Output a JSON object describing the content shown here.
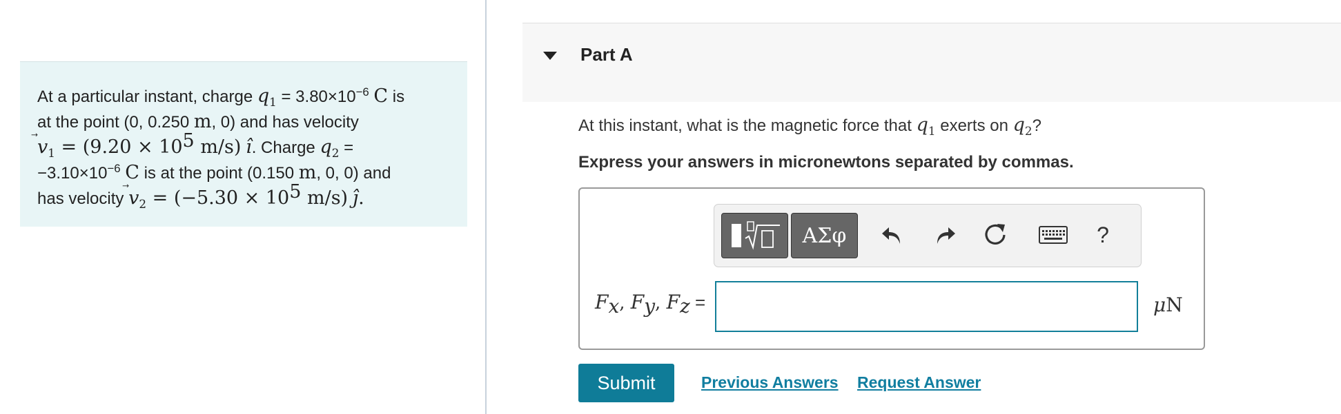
{
  "problem": {
    "l1_a": "At a particular instant, charge ",
    "q1_sym": "q",
    "q1_sub": "1",
    "l1_b": " = 3.80×10",
    "q1_exp": "−6",
    "l1_unit": "C",
    "l1_c": " is",
    "l2_a": "at the point (0, 0.250 ",
    "l2_unit": "m",
    "l2_b": ", 0) and has velocity",
    "v1_sym": "v",
    "v1_sub": "1",
    "v1_eq": " = ",
    "v1_val": "(9.20 × 10",
    "v1_exp": "5",
    "v1_unit": " m/s)",
    "v1_dir": "ı̂",
    "l3_b": ". Charge ",
    "q2_sym": "q",
    "q2_sub": "2",
    "l3_c": " =",
    "l4_a": "−3.10×10",
    "q2_exp": "−6",
    "l4_unit": "C",
    "l4_b": " is at the point (0.150 ",
    "l4_unit2": "m",
    "l4_c": ", 0, 0) and",
    "l5_a": "has velocity ",
    "v2_sym": "v",
    "v2_sub": "2",
    "v2_eq": " = ",
    "v2_val": "(−5.30 × 10",
    "v2_exp": "5",
    "v2_unit": " m/s)",
    "v2_dir": "ȷ̂",
    "v2_end": "."
  },
  "part": {
    "title": "Part A"
  },
  "question": {
    "text_a": "At this instant, what is the magnetic force that ",
    "q1": "q",
    "q1_sub": "1",
    "text_b": " exerts on ",
    "q2": "q",
    "q2_sub": "2",
    "text_c": "?"
  },
  "instruction": "Express your answers in micronewtons separated by commas.",
  "toolbar": {
    "symbols_label": "ΑΣφ",
    "help_label": "?",
    "icons": [
      "templates-icon",
      "undo-icon",
      "redo-icon",
      "reset-icon",
      "keyboard-icon",
      "help-icon"
    ]
  },
  "answer": {
    "fx": "F",
    "fx_sub": "x",
    "fy": "F",
    "fy_sub": "y",
    "fz": "F",
    "fz_sub": "z",
    "sep": ", ",
    "eq": " =",
    "value": "",
    "unit_mu": "μ",
    "unit_n": "N"
  },
  "buttons": {
    "submit": "Submit",
    "previous_answers": "Previous Answers",
    "request_answer": "Request Answer"
  },
  "colors": {
    "accent": "#0f7c98",
    "link": "#117ea0",
    "problem_bg": "#e8f5f6"
  }
}
